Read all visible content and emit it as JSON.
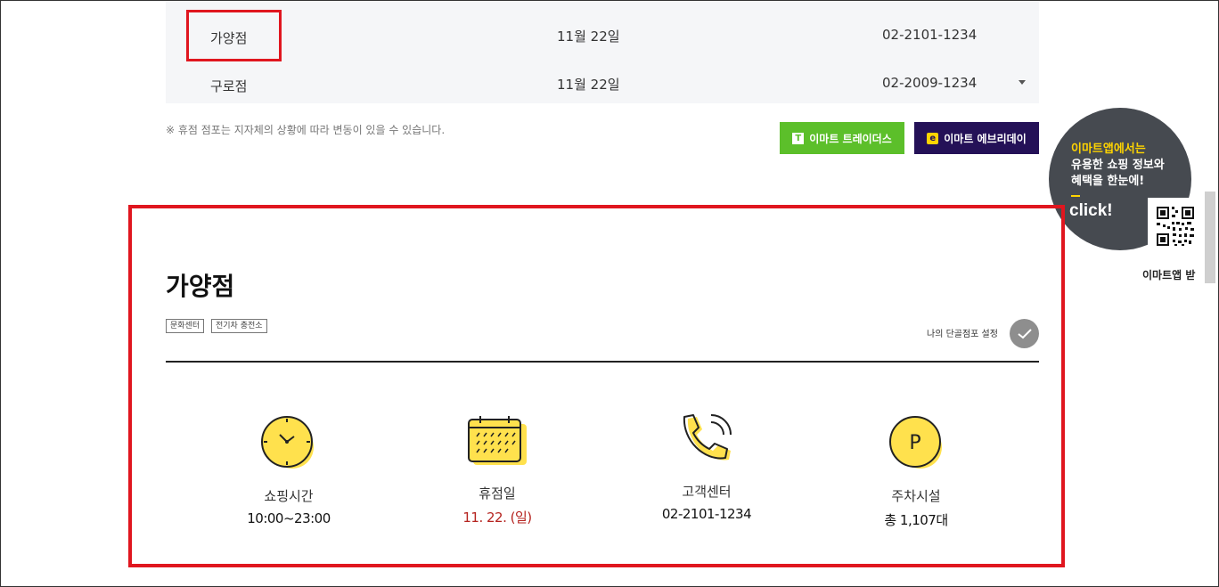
{
  "store_table": {
    "rows": [
      {
        "name": "가양점",
        "date": "11월 22일",
        "phone": "02-2101-1234"
      },
      {
        "name": "구로점",
        "date": "11월 22일",
        "phone": "02-2009-1234"
      }
    ]
  },
  "notice": "※ 휴점 점포는 지자체의 상황에 따라 변동이 있을 수 있습니다.",
  "buttons": {
    "traders": {
      "logo": "T",
      "label": "이마트 트레이더스"
    },
    "everyday": {
      "logo": "e",
      "label": "이마트 에브리데이"
    }
  },
  "app_promo": {
    "line1": "이마트앱에서는",
    "line2": "유용한 쇼핑 정보와",
    "line3": "혜택을 한눈에!",
    "click": "click!",
    "bottom": "이마트앱 받"
  },
  "store_detail": {
    "name": "가양점",
    "tags": [
      "문화센터",
      "전기차 충전소"
    ],
    "favorite_label": "나의 단골점포 설정",
    "info": [
      {
        "icon": "clock-icon",
        "label": "쇼핑시간",
        "value": "10:00~23:00"
      },
      {
        "icon": "calendar-icon",
        "label": "휴점일",
        "value": "11. 22. (일)"
      },
      {
        "icon": "phone-icon",
        "label": "고객센터",
        "value": "02-2101-1234"
      },
      {
        "icon": "parking-icon",
        "label": "주차시설",
        "value": "총 1,107대"
      }
    ]
  },
  "colors": {
    "highlight": "#e0161f",
    "icon_yellow": "#ffe14d",
    "traders_green": "#5cbf2a",
    "everyday_navy": "#241157",
    "holiday_red": "#b5231f"
  }
}
